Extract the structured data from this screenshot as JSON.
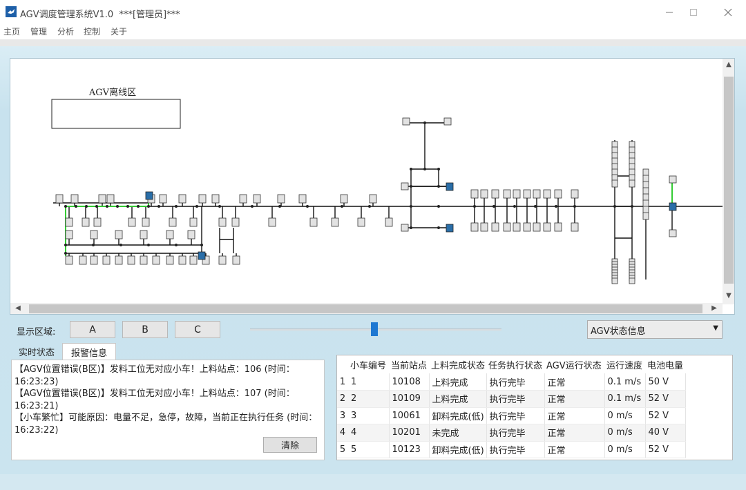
{
  "window": {
    "title": "AGV调度管理系统V1.0  ***[管理员]***",
    "app_icon": "bird-logo-icon",
    "controls": [
      "minimize-icon",
      "maximize-icon",
      "close-icon"
    ]
  },
  "menu": [
    "主页",
    "管理",
    "分析",
    "控制",
    "关于"
  ],
  "map": {
    "offline_zone_label": "AGV离线区",
    "colors": {
      "track": "#111111",
      "active_route": "#33cc33",
      "highlight_station": "#2a6ea8"
    }
  },
  "controls": {
    "area_label": "显示区域:",
    "area_buttons": [
      "A",
      "B",
      "C"
    ],
    "status_dropdown": "AGV状态信息"
  },
  "tabs": [
    {
      "label": "实时状态",
      "active": false
    },
    {
      "label": "报警信息",
      "active": true
    }
  ],
  "alarms": [
    "【AGV位置错误(B区)】发料工位无对应小车！上料站点：106 (时间：16:23:23)",
    "【AGV位置错误(B区)】发料工位无对应小车！上料站点：107 (时间：16:23:21)",
    "【小车繁忙】可能原因：电量不足，急停，故障，当前正在执行任务 (时间：16:23:22)"
  ],
  "clear_button": "清除",
  "table": {
    "columns": [
      "小车编号",
      "当前站点",
      "上料完成状态",
      "任务执行状态",
      "AGV运行状态",
      "运行速度",
      "电池电量"
    ],
    "rows": [
      {
        "n": "1",
        "cells": [
          "1",
          "10108",
          "上料完成",
          "执行完毕",
          "正常",
          "0.1 m/s",
          "50 V"
        ]
      },
      {
        "n": "2",
        "cells": [
          "2",
          "10109",
          "上料完成",
          "执行完毕",
          "正常",
          "0.1 m/s",
          "52 V"
        ]
      },
      {
        "n": "3",
        "cells": [
          "3",
          "10061",
          "卸料完成(低)",
          "执行完毕",
          "正常",
          "0 m/s",
          "52 V"
        ]
      },
      {
        "n": "4",
        "cells": [
          "4",
          "10201",
          "未完成",
          "执行完毕",
          "正常",
          "0 m/s",
          "40 V"
        ]
      },
      {
        "n": "5",
        "cells": [
          "5",
          "10123",
          "卸料完成(低)",
          "执行完毕",
          "正常",
          "0 m/s",
          "52 V"
        ]
      }
    ]
  }
}
